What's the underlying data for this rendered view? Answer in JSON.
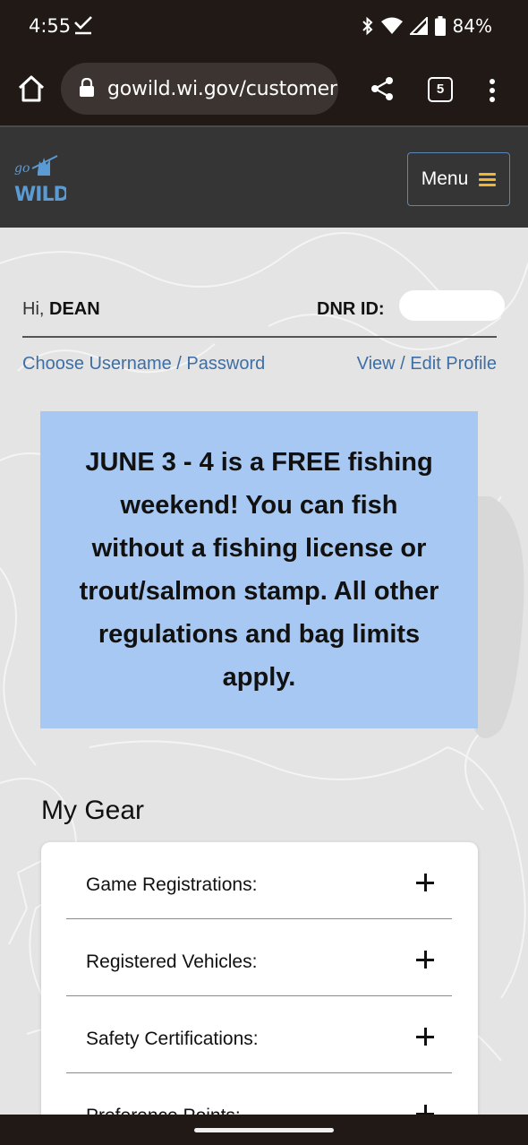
{
  "status_bar": {
    "time": "4:55",
    "battery": "84%"
  },
  "browser": {
    "url": "gowild.wi.gov/customer",
    "tab_count": "5"
  },
  "header": {
    "logo_text": "go WILD",
    "menu_label": "Menu"
  },
  "account": {
    "greeting_prefix": "Hi,",
    "user_name": "DEAN",
    "dnr_label": "DNR ID:",
    "choose_username_link": "Choose Username / Password",
    "edit_profile_link": "View / Edit Profile"
  },
  "notice": {
    "text": "JUNE 3 - 4 is a FREE fishing weekend!  You can fish without a fishing license or trout/salmon stamp.  All other regulations and bag limits apply."
  },
  "gear": {
    "title": "My Gear",
    "items": [
      {
        "label": "Game Registrations:"
      },
      {
        "label": "Registered Vehicles:"
      },
      {
        "label": "Safety Certifications:"
      },
      {
        "label": "Preference Points:"
      }
    ]
  },
  "colors": {
    "notice_bg": "#a6c8f2",
    "link": "#3d6ea5",
    "menu_accent": "#f2b632",
    "header_bg": "#353535"
  }
}
